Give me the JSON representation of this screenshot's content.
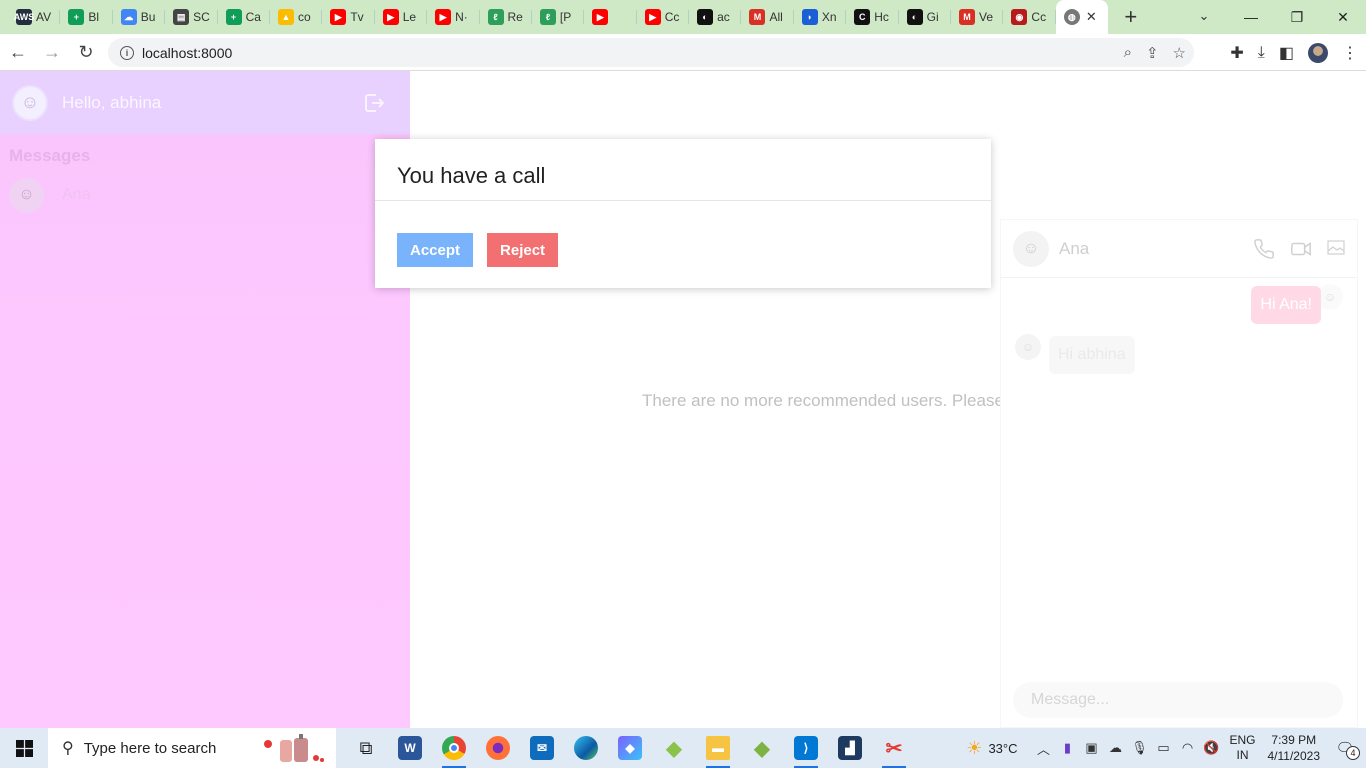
{
  "browser": {
    "tabs": [
      {
        "label": "AV",
        "fav": "AWS",
        "color": "#232f3e"
      },
      {
        "label": "Bl",
        "fav": "+",
        "color": "#0f9d58"
      },
      {
        "label": "Bu",
        "fav": "☁",
        "color": "#4285f4"
      },
      {
        "label": "SC",
        "fav": "▤",
        "color": "#444444"
      },
      {
        "label": "Ca",
        "fav": "+",
        "color": "#0f9d58"
      },
      {
        "label": "co",
        "fav": "▲",
        "color": "#fbbc04"
      },
      {
        "label": "Tv",
        "fav": "▶",
        "color": "#ff0000"
      },
      {
        "label": "Le",
        "fav": "▶",
        "color": "#ff0000"
      },
      {
        "label": "N·",
        "fav": "▶",
        "color": "#ff0000"
      },
      {
        "label": "Re",
        "fav": "ℓ",
        "color": "#2e9e5b"
      },
      {
        "label": "[P",
        "fav": "ℓ",
        "color": "#2e9e5b"
      },
      {
        "label": "",
        "fav": "▶",
        "color": "#ff0000"
      },
      {
        "label": "Cc",
        "fav": "▶",
        "color": "#ff0000"
      },
      {
        "label": "ac",
        "fav": "◐",
        "color": "#111111"
      },
      {
        "label": "All",
        "fav": "M",
        "color": "#d93025"
      },
      {
        "label": "Xn",
        "fav": "◗",
        "color": "#1a5fd6"
      },
      {
        "label": "Hc",
        "fav": "C",
        "color": "#111111"
      },
      {
        "label": "Gi",
        "fav": "◐",
        "color": "#111111"
      },
      {
        "label": "Ve",
        "fav": "M",
        "color": "#d93025"
      },
      {
        "label": "Cc",
        "fav": "◉",
        "color": "#b71c1c"
      }
    ],
    "active_tab_close": "✕",
    "new_tab": "+",
    "url": "localhost:8000"
  },
  "sidebar": {
    "greeting": "Hello, abhina",
    "messages_title": "Messages",
    "contacts": [
      {
        "name": "Ana"
      }
    ]
  },
  "main": {
    "empty_text": "There are no more recommended users. Please"
  },
  "chat": {
    "contact_name": "Ana",
    "messages": [
      {
        "from": "me",
        "text": "Hi Ana!"
      },
      {
        "from": "them",
        "text": "Hi abhina"
      }
    ],
    "input_placeholder": "Message..."
  },
  "modal": {
    "title": "You have a call",
    "accept_label": "Accept",
    "reject_label": "Reject"
  },
  "taskbar": {
    "search_placeholder": "Type here to search",
    "temperature": "33°C",
    "lang_line1": "ENG",
    "lang_line2": "IN",
    "time": "7:39 PM",
    "date": "4/11/2023",
    "notification_count": "4"
  },
  "colors": {
    "sidebar_bg": "#fdc8ff",
    "accept": "#78b3fb",
    "reject": "#f26f72"
  }
}
